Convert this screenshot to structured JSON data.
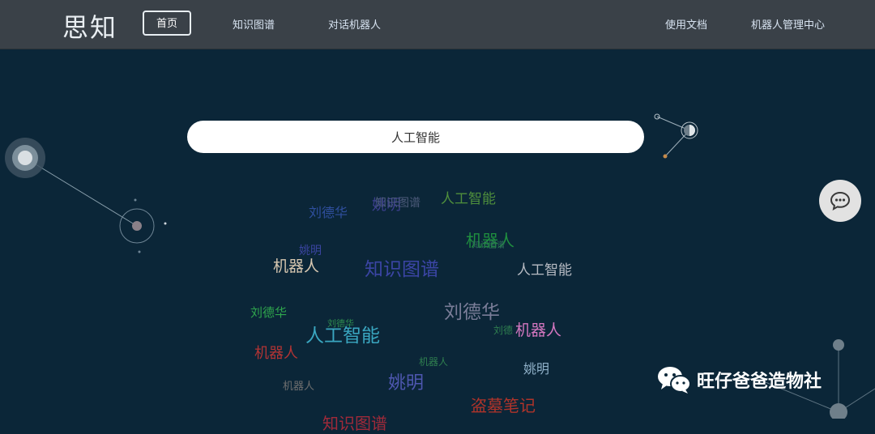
{
  "header": {
    "logo": "思知",
    "nav_home": "首页",
    "nav_kg": "知识图谱",
    "nav_chatbot": "对话机器人",
    "nav_docs": "使用文档",
    "nav_admin": "机器人管理中心"
  },
  "search": {
    "value": "人工智能"
  },
  "word_cloud": {
    "words": [
      {
        "text": "刘德华",
        "color": "#2f4f9e"
      },
      {
        "text": "姚明",
        "color": "#3c3f8f"
      },
      {
        "text": "知识图谱",
        "color": "#4c5a7a"
      },
      {
        "text": "人工智能",
        "color": "#4f8f3c"
      },
      {
        "text": "机器人",
        "color": "#1f8f3f"
      },
      {
        "text": "知识图谱",
        "color": "#2f6f5a"
      },
      {
        "text": "姚明",
        "color": "#3a44a0"
      },
      {
        "text": "机器人",
        "color": "#d7c7b0"
      },
      {
        "text": "知识图谱",
        "color": "#3b45a5"
      },
      {
        "text": "人工智能",
        "color": "#b8bcc4"
      },
      {
        "text": "刘德华",
        "color": "#2fa64d"
      },
      {
        "text": "刘德华",
        "color": "#2f8f4f"
      },
      {
        "text": "刘德华",
        "color": "#7a7d98"
      },
      {
        "text": "人工智能",
        "color": "#3aa6c0"
      },
      {
        "text": "刘德",
        "color": "#2f7f4f"
      },
      {
        "text": "机器人",
        "color": "#d477c0"
      },
      {
        "text": "机器人",
        "color": "#b23434"
      },
      {
        "text": "机器人",
        "color": "#2f7f4f"
      },
      {
        "text": "姚明",
        "color": "#8fb0c8"
      },
      {
        "text": "机器人",
        "color": "#6f6f6f"
      },
      {
        "text": "姚明",
        "color": "#4e57b0"
      },
      {
        "text": "盗墓笔记",
        "color": "#b0342a"
      },
      {
        "text": "知识图谱",
        "color": "#a02a3a"
      }
    ]
  },
  "watermark": {
    "text": "旺仔爸爸造物社"
  },
  "colors": {
    "background": "#0b2638",
    "topbar": "#3a4148",
    "chat_button": "#e2e2e2"
  },
  "icons": {
    "chat": "chat-bubble-icon",
    "wechat": "wechat-icon"
  }
}
